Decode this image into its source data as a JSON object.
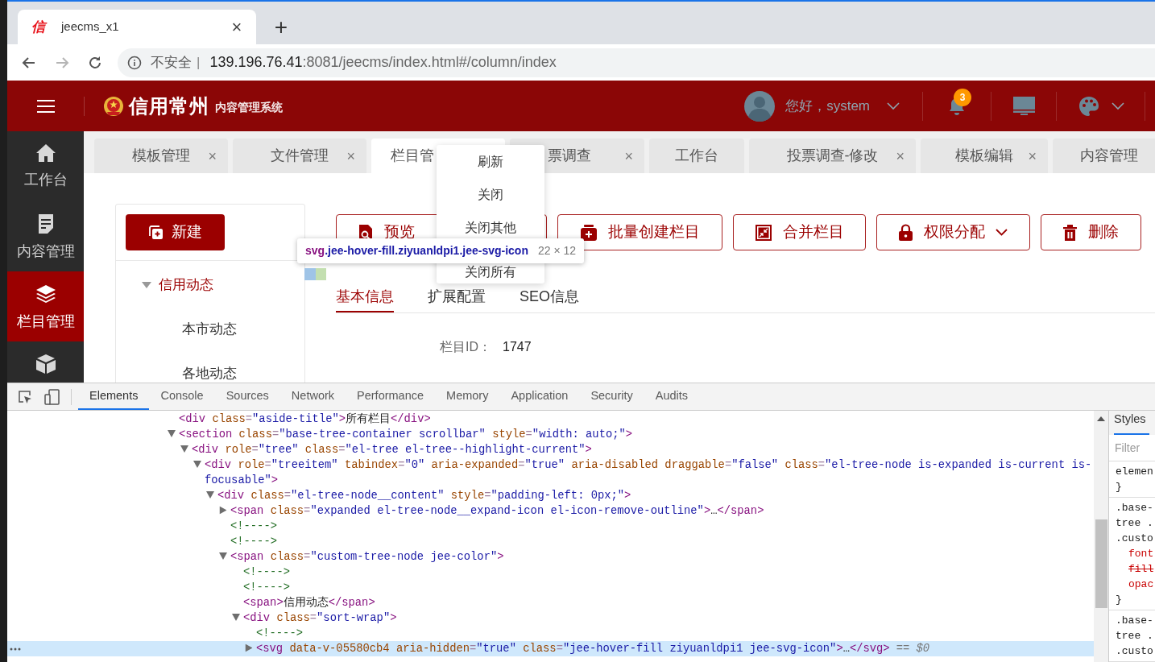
{
  "browser": {
    "tab": {
      "favicon": "信",
      "title": "jeecms_x1",
      "close": "×"
    },
    "new_tab": "+",
    "address": {
      "security": "不安全",
      "separator": "|",
      "host": "139.196.76.41",
      "path": ":8081/jeecms/index.html#/column/index"
    }
  },
  "header": {
    "logo_title": "信用常州",
    "logo_subtitle": "内容管理系统",
    "greeting": "您好，system",
    "notifications": "3"
  },
  "sidebar": {
    "items": [
      {
        "label": "工作台",
        "selected": false
      },
      {
        "label": "内容管理",
        "selected": false
      },
      {
        "label": "栏目管理",
        "selected": true
      },
      {
        "selected": false
      }
    ]
  },
  "tabs": [
    {
      "label": "模板管理",
      "close": "×",
      "selected": false
    },
    {
      "label": "文件管理",
      "close": "×",
      "selected": false
    },
    {
      "label": "栏目管",
      "selected": true
    },
    {
      "label": "票调查",
      "close": "×",
      "selected": false
    },
    {
      "label": "工作台",
      "selected": false
    },
    {
      "label": "投票调查-修改",
      "close": "×",
      "selected": false
    },
    {
      "label": "模板编辑",
      "close": "×",
      "selected": false
    },
    {
      "label": "内容管理",
      "selected": false
    }
  ],
  "context_menu": [
    "刷新",
    "关闭",
    "关闭其他",
    "关闭所有"
  ],
  "tooltip": {
    "selector": "svg.jee-hover-fill.ziyuanldpi1.jee-svg-icon",
    "size": "22 × 12"
  },
  "tree_panel": {
    "new_button": "新建",
    "tree": [
      {
        "label": "信用动态",
        "expanded": true,
        "selected": true,
        "children": [
          {
            "label": "本市动态",
            "selected": false
          },
          {
            "label": "各地动态",
            "selected": false
          }
        ]
      }
    ]
  },
  "actions": [
    {
      "label": "预览",
      "dropdown": false
    },
    {
      "label": "批量创建栏目",
      "dropdown": false
    },
    {
      "label": "合并栏目",
      "dropdown": false
    },
    {
      "label": "权限分配",
      "dropdown": true
    },
    {
      "label": "删除",
      "dropdown": false
    }
  ],
  "detail_tabs": [
    {
      "label": "基本信息",
      "selected": true
    },
    {
      "label": "扩展配置",
      "selected": false
    },
    {
      "label": "SEO信息",
      "selected": false
    }
  ],
  "fields": [
    {
      "label": "栏目ID：",
      "value": "1747"
    }
  ],
  "devtools": {
    "tabs": [
      {
        "label": "Elements",
        "selected": true
      },
      {
        "label": "Console",
        "selected": false
      },
      {
        "label": "Sources",
        "selected": false
      },
      {
        "label": "Network",
        "selected": false
      },
      {
        "label": "Performance",
        "selected": false
      },
      {
        "label": "Memory",
        "selected": false
      },
      {
        "label": "Application",
        "selected": false
      },
      {
        "label": "Security",
        "selected": false
      },
      {
        "label": "Audits",
        "selected": false
      }
    ],
    "dom": [
      {
        "text": "<div class=\"aside-title\">所有栏目</div>",
        "selected": false
      },
      {
        "text": "<section class=\"base-tree-container scrollbar\" style=\"width: auto;\">",
        "expanded": true,
        "selected": false,
        "children": [
          {
            "text": "<div role=\"tree\" class=\"el-tree el-tree--highlight-current\">",
            "expanded": true,
            "selected": false,
            "children": [
              {
                "text": "<div role=\"treeitem\" tabindex=\"0\" aria-expanded=\"true\" aria-disabled draggable=\"false\" class=\"el-tree-node is-expanded is-current is-focusable\">",
                "expanded": true,
                "selected": false,
                "children": [
                  {
                    "text": "<div class=\"el-tree-node__content\" style=\"padding-left: 0px;\">",
                    "expanded": true,
                    "selected": false,
                    "children": [
                      {
                        "text": "<span class=\"expanded el-tree-node__expand-icon el-icon-remove-outline\">…</span>",
                        "expanded": false,
                        "selected": false
                      },
                      {
                        "text": "<!---->",
                        "selected": false
                      },
                      {
                        "text": "<!---->",
                        "selected": false
                      },
                      {
                        "text": "<span class=\"custom-tree-node jee-color\">",
                        "expanded": true,
                        "selected": false,
                        "children": [
                          {
                            "text": "<!---->",
                            "selected": false
                          },
                          {
                            "text": "<!---->",
                            "selected": false
                          },
                          {
                            "text": "<span>信用动态</span>",
                            "selected": false
                          },
                          {
                            "text": "<div class=\"sort-wrap\">",
                            "expanded": true,
                            "selected": false,
                            "children": [
                              {
                                "text": "<!---->",
                                "selected": false
                              },
                              {
                                "text": "<svg data-v-05580cb4 aria-hidden=\"true\" class=\"jee-hover-fill ziyuanldpi1 jee-svg-icon\">…</svg>",
                                "expanded": false,
                                "selected": true,
                                "marker": "== $0"
                              }
                            ]
                          }
                        ]
                      }
                    ]
                  }
                ]
              }
            ]
          }
        ]
      }
    ],
    "styles": {
      "tab": "Styles",
      "filter_placeholder": "Filter",
      "rules": [
        {
          "selector": [
            "elemen"
          ],
          "close": "}"
        },
        {
          "selector": [
            ".base-",
            "tree .",
            ".custo"
          ],
          "declarations": [
            {
              "text": "font",
              "overridden": false
            },
            {
              "text": "fill",
              "overridden": true
            },
            {
              "text": "opac",
              "overridden": false
            }
          ],
          "close": "}"
        },
        {
          "selector": [
            ".base-",
            "tree .",
            ".custo"
          ]
        }
      ]
    }
  }
}
